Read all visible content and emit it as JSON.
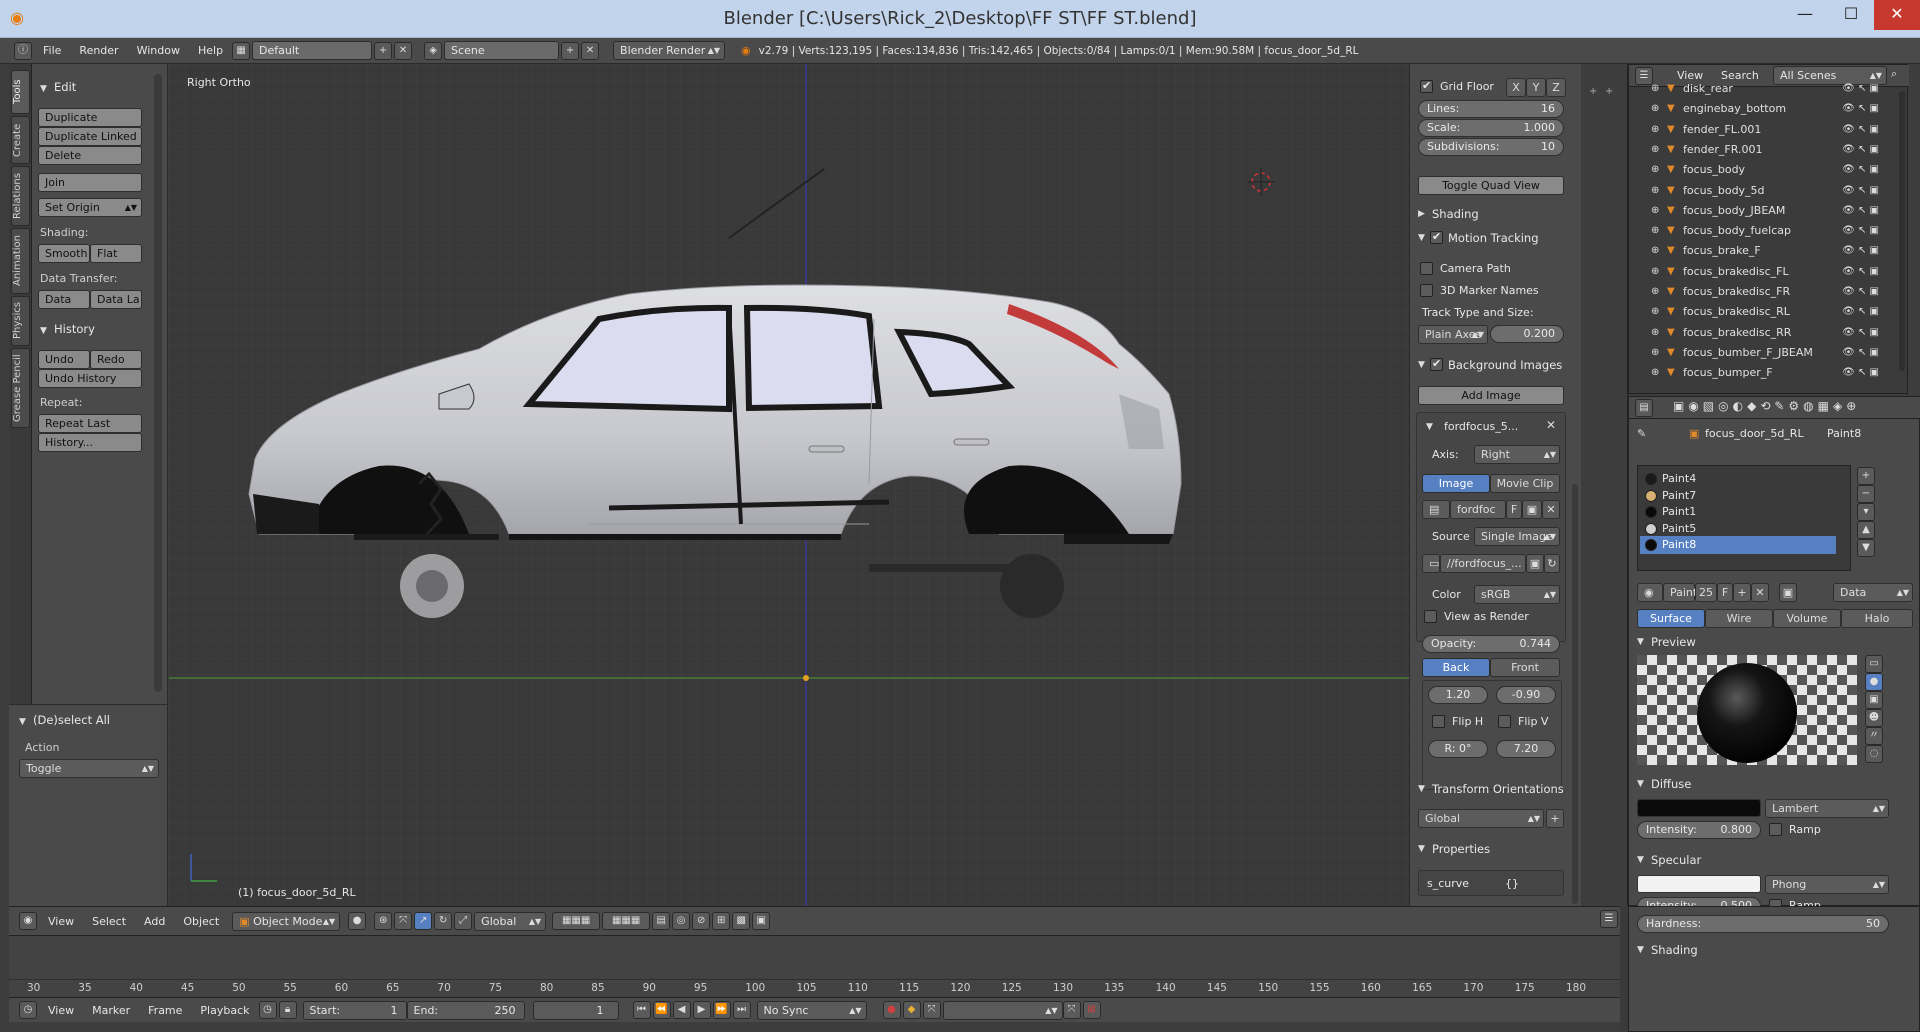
{
  "window": {
    "title": "Blender [C:\\Users\\Rick_2\\Desktop\\FF ST\\FF ST.blend]",
    "minimize": "—",
    "maximize": "☐",
    "close": "✕"
  },
  "infobar": {
    "menus": [
      "File",
      "Render",
      "Window",
      "Help"
    ],
    "layout": "Default",
    "scene": "Scene",
    "engine": "Blender Render",
    "stats": "v2.79 | Verts:123,195 | Faces:134,836 | Tris:142,465 | Objects:0/84 | Lamps:0/1 | Mem:90.58M | focus_door_5d_RL"
  },
  "tabs": [
    "Tools",
    "Create",
    "Relations",
    "Animation",
    "Physics",
    "Grease Pencil"
  ],
  "toolshelf": {
    "edit_header": "Edit",
    "duplicate": "Duplicate",
    "duplicate_linked": "Duplicate Linked",
    "delete": "Delete",
    "join": "Join",
    "set_origin": "Set Origin",
    "shading_label": "Shading:",
    "smooth": "Smooth",
    "flat": "Flat",
    "data_transfer_label": "Data Transfer:",
    "data": "Data",
    "data_la": "Data La",
    "history_header": "History",
    "undo": "Undo",
    "redo": "Redo",
    "undo_history": "Undo History",
    "repeat_label": "Repeat:",
    "repeat_last": "Repeat Last",
    "history_btn": "History...",
    "deselect_header": "(De)select All",
    "action_label": "Action",
    "action_value": "Toggle"
  },
  "viewport": {
    "view_name": "Right Ortho",
    "object_label": "(1) focus_door_5d_RL"
  },
  "npanel": {
    "grid_floor": "Grid Floor",
    "x": "X",
    "y": "Y",
    "z": "Z",
    "lines_label": "Lines:",
    "lines_value": "16",
    "scale_label": "Scale:",
    "scale_value": "1.000",
    "subdiv_label": "Subdivisions:",
    "subdiv_value": "10",
    "toggle_quad": "Toggle Quad View",
    "shading": "Shading",
    "motion_tracking": "Motion Tracking",
    "camera_path": "Camera Path",
    "marker_names": "3D Marker Names",
    "track_type_label": "Track Type and Size:",
    "plain_axes": "Plain Axes",
    "track_size": "0.200",
    "bg_images": "Background Images",
    "add_image": "Add Image",
    "bg_name": "fordfocus_5...",
    "axis_label": "Axis:",
    "axis_value": "Right",
    "image_tab": "Image",
    "movie_tab": "Movie Clip",
    "img_field": "fordfoc",
    "img_f": "F",
    "source_label": "Source",
    "source_value": "Single Image",
    "path_value": "//fordfocus_...",
    "color_label": "Color",
    "color_value": "sRGB",
    "view_as_render": "View as Render",
    "opacity_label": "Opacity:",
    "opacity_value": "0.744",
    "back": "Back",
    "front": "Front",
    "offset_x": "1.20",
    "offset_y": "-0.90",
    "flip_h": "Flip H",
    "flip_v": "Flip V",
    "rotation": "R: 0°",
    "size": "7.20",
    "transform_orient": "Transform Orientations",
    "global": "Global",
    "properties": "Properties",
    "s_curve": "s_curve",
    "s_curve_val": "{}"
  },
  "outliner": {
    "view": "View",
    "search": "Search",
    "scenes": "All Scenes",
    "items": [
      "disk_rear",
      "enginebay_bottom",
      "fender_FL.001",
      "fender_FR.001",
      "focus_body",
      "focus_body_5d",
      "focus_body_JBEAM",
      "focus_body_fuelcap",
      "focus_brake_F",
      "focus_brakedisc_FL",
      "focus_brakedisc_FR",
      "focus_brakedisc_RL",
      "focus_brakedisc_RR",
      "focus_bumber_F_JBEAM",
      "focus_bumper_F"
    ]
  },
  "properties": {
    "object": "focus_door_5d_RL",
    "material": "Paint8",
    "slots": [
      {
        "name": "Paint4",
        "color": "#1a1a1a"
      },
      {
        "name": "Paint7",
        "color": "#d6b070"
      },
      {
        "name": "Paint1",
        "color": "#0a0a0a"
      },
      {
        "name": "Paint5",
        "color": "#cfcfcf"
      },
      {
        "name": "Paint8",
        "color": "#0a0a0a"
      }
    ],
    "mat_name": "Paint8",
    "users": "25",
    "f": "F",
    "data": "Data",
    "tabs": [
      "Surface",
      "Wire",
      "Volume",
      "Halo"
    ],
    "preview": "Preview",
    "diffuse": "Diffuse",
    "diffuse_shader": "Lambert",
    "diffuse_int_label": "Intensity:",
    "diffuse_int": "0.800",
    "ramp": "Ramp",
    "specular": "Specular",
    "spec_shader": "Phong",
    "spec_int_label": "Intensity:",
    "spec_int": "0.500",
    "hardness_label": "Hardness:",
    "hardness": "50",
    "shading": "Shading"
  },
  "header3d": {
    "view": "View",
    "select": "Select",
    "add": "Add",
    "object": "Object",
    "mode": "Object Mode",
    "orientation": "Global"
  },
  "timeline": {
    "ticks": [
      "30",
      "35",
      "40",
      "45",
      "50",
      "55",
      "60",
      "65",
      "70",
      "75",
      "80",
      "85",
      "90",
      "95",
      "100",
      "105",
      "110",
      "115",
      "120",
      "125",
      "130",
      "135",
      "140",
      "145",
      "150",
      "155",
      "160",
      "165",
      "170",
      "175",
      "180"
    ]
  },
  "footer": {
    "view": "View",
    "marker": "Marker",
    "frame": "Frame",
    "playback": "Playback",
    "start_label": "Start:",
    "start": "1",
    "end_label": "End:",
    "end": "250",
    "current": "1",
    "sync": "No Sync"
  }
}
